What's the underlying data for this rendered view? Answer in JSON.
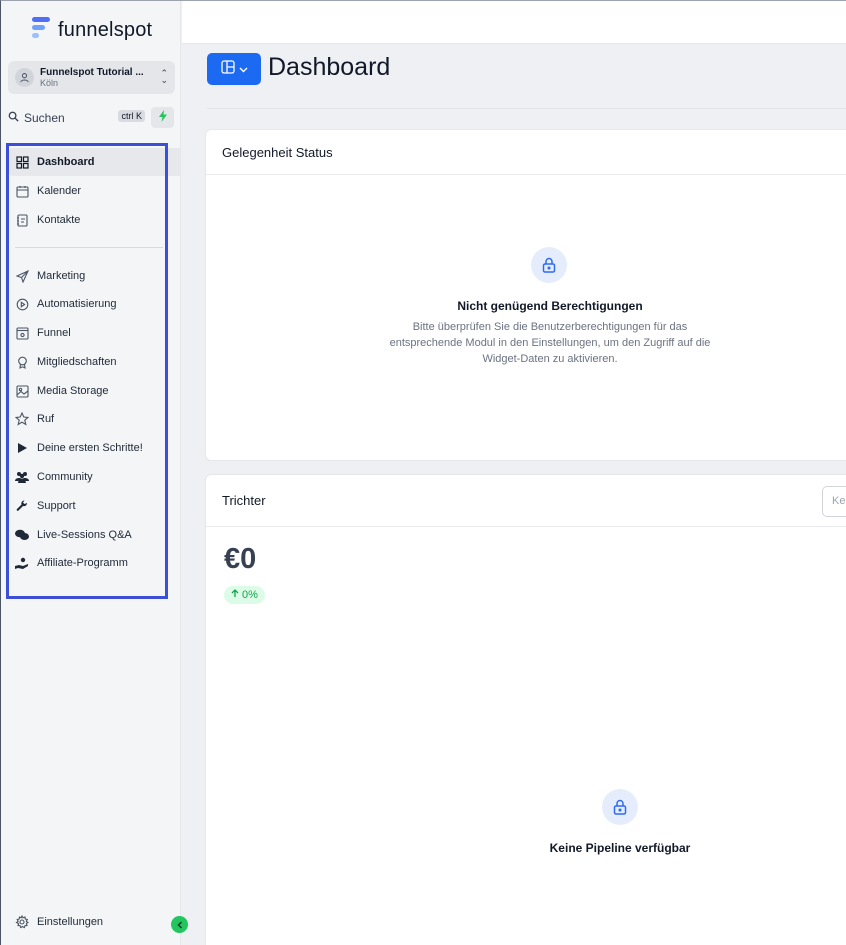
{
  "brand": {
    "name": "funnelspot",
    "colors": [
      "#4f6df5",
      "#6ea0ff",
      "#9cc0ff"
    ]
  },
  "account": {
    "name": "Funnelspot Tutorial ...",
    "location": "Köln"
  },
  "search": {
    "label": "Suchen",
    "shortcut": "ctrl K"
  },
  "sidebar": {
    "items": [
      {
        "label": "Dashboard",
        "icon": "dashboard-grid-icon",
        "active": true
      },
      {
        "label": "Kalender",
        "icon": "calendar-icon"
      },
      {
        "label": "Kontakte",
        "icon": "contacts-book-icon"
      },
      {
        "label": "Marketing",
        "icon": "send-icon"
      },
      {
        "label": "Automatisierung",
        "icon": "play-circle-icon"
      },
      {
        "label": "Funnel",
        "icon": "funnel-window-icon"
      },
      {
        "label": "Mitgliedschaften",
        "icon": "badge-icon"
      },
      {
        "label": "Media Storage",
        "icon": "image-icon"
      },
      {
        "label": "Ruf",
        "icon": "star-icon"
      },
      {
        "label": "Deine ersten Schritte!",
        "icon": "play-icon"
      },
      {
        "label": "Community",
        "icon": "users-icon"
      },
      {
        "label": "Support",
        "icon": "wrench-icon"
      },
      {
        "label": "Live-Sessions Q&A",
        "icon": "chat-bubbles-icon"
      },
      {
        "label": "Affiliate-Programm",
        "icon": "hand-coin-icon"
      }
    ],
    "settings_label": "Einstellungen"
  },
  "header": {
    "title": "Dashboard"
  },
  "cards": {
    "status": {
      "title": "Gelegenheit Status",
      "message_title": "Nicht genügend Berechtigungen",
      "message_body": "Bitte überprüfen Sie die Benutzerberechtigungen für das entsprechende Modul in den Einstellungen, um den Zugriff auf die Widget-Daten zu aktivieren."
    },
    "funnel": {
      "title": "Trichter",
      "filter_placeholder": "Ke",
      "value": "€0",
      "change": "0%",
      "empty_message": "Keine Pipeline verfügbar"
    }
  },
  "accent": "#1d6af2",
  "highlight_box_color": "#3b4fd8"
}
